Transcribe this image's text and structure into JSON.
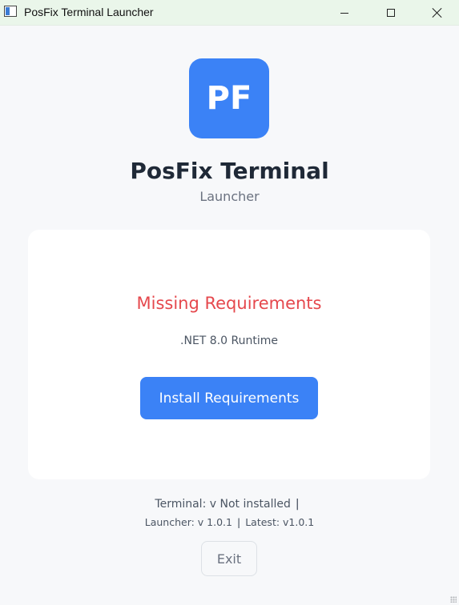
{
  "window": {
    "title": "PosFix Terminal Launcher"
  },
  "header": {
    "logo_text": "PF",
    "app_name": "PosFix Terminal",
    "subtitle": "Launcher"
  },
  "card": {
    "title": "Missing Requirements",
    "detail": ".NET 8.0 Runtime",
    "install_label": "Install Requirements"
  },
  "footer": {
    "terminal_text": "Terminal: v Not installed",
    "separator": "|",
    "launcher_text": "Launcher: v 1.0.1",
    "latest_text": "Latest: v1.0.1",
    "exit_label": "Exit"
  },
  "colors": {
    "accent": "#3b82f6",
    "error": "#e5484d",
    "background": "#f7f8fa"
  }
}
